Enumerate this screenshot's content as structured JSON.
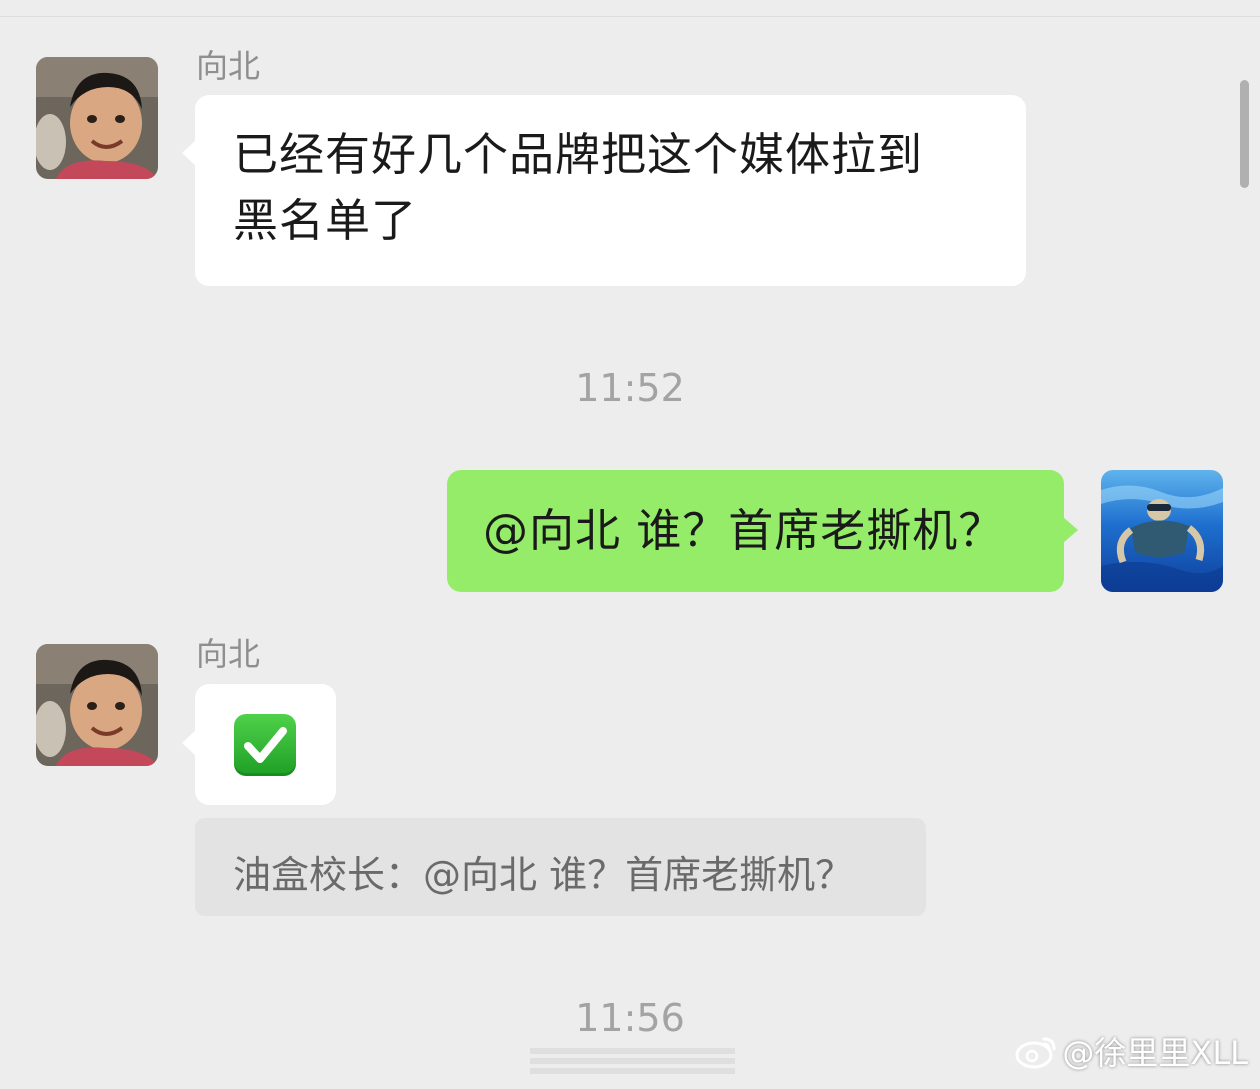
{
  "messages": [
    {
      "sender": "向北",
      "direction": "incoming",
      "lines": [
        "已经有好几个品牌把这个媒体拉到",
        "黑名单了"
      ]
    },
    {
      "timestamp": "11:52"
    },
    {
      "direction": "outgoing",
      "text": "@向北 谁？首席老撕机？"
    },
    {
      "sender": "向北",
      "direction": "incoming",
      "emoji": "check-mark-button",
      "quote": "油盒校长：@向北 谁？首席老撕机？"
    },
    {
      "timestamp": "11:56"
    }
  ],
  "watermark": "@徐里里XLL",
  "colors": {
    "background": "#ededed",
    "incoming_bubble": "#ffffff",
    "outgoing_bubble": "#95ec69",
    "quote_bg": "#e3e3e3"
  }
}
